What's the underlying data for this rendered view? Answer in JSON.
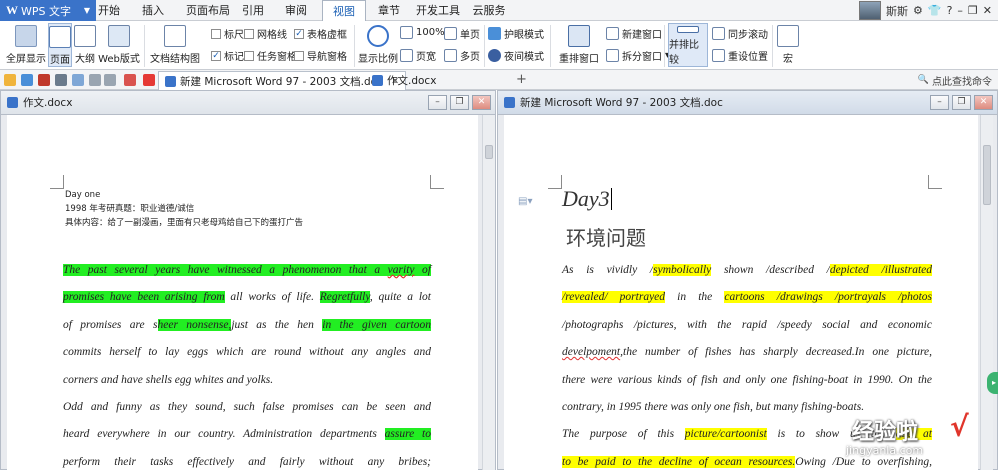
{
  "app": {
    "name": "WPS 文字",
    "logo_letter": "W"
  },
  "menu_tabs": [
    "开始",
    "插入",
    "页面布局",
    "引用",
    "审阅",
    "视图",
    "章节",
    "开发工具",
    "云服务"
  ],
  "active_menu_tab": "视图",
  "user": {
    "name": "斯斯"
  },
  "ribbon": {
    "full_display": "全屏显示",
    "page_view": "页面",
    "outline_view": "大纲",
    "web_view": "Web版式",
    "doc_structure": "文档结构图",
    "ruler": "标尺",
    "gridlines": "网格线",
    "table_frame": "表格虚框",
    "marks": "标记",
    "task_pane": "任务窗格",
    "nav_pane": "导航窗格",
    "zoom": "显示比例",
    "zoom_100": "100%",
    "page_width": "页宽",
    "single_page": "单页",
    "multi_page": "多页",
    "eye_mode": "护眼模式",
    "night_mode": "夜间模式",
    "rearrange": "重排窗口",
    "new_window": "新建窗口",
    "split_window": "拆分窗口",
    "side_by_side": "并排比较",
    "sync_scroll": "同步滚动",
    "reset_position": "重设位置",
    "macro": "宏"
  },
  "doc_tabs": [
    {
      "label": "新建 Microsoft Word 97 - 2003 文档.doc",
      "active": true
    },
    {
      "label": "作文.docx",
      "active": false
    }
  ],
  "search_label": "点此查找命令",
  "left_pane": {
    "title": "作文.docx",
    "header_lines": [
      "Day one",
      "1998 年考研真题：职业道德/诚信",
      "具体内容：给了一副漫画，里面有只老母鸡给自己下的蛋打广告"
    ],
    "paragraph_lines": [
      [
        {
          "t": "The past several years have witnessed a phenomenon that a ",
          "h": true
        },
        {
          "t": "varity",
          "h": true,
          "u": true
        },
        {
          "t": " of",
          "h": true
        }
      ],
      [
        {
          "t": "promises have been arising from",
          "h": true
        },
        {
          "t": " all works of life. ",
          "h": false
        },
        {
          "t": "Regretfully",
          "h": true
        },
        {
          "t": ", quite a lot",
          "h": false
        }
      ],
      [
        {
          "t": "of promises are s",
          "h": false
        },
        {
          "t": "heer nonsense,",
          "h": true
        },
        {
          "t": "just as the hen ",
          "h": false
        },
        {
          "t": "in the given cartoon",
          "h": true
        }
      ],
      [
        {
          "t": "commits herself to lay eggs which are round without any angles and",
          "h": false
        }
      ],
      [
        {
          "t": "corners and have shells egg whites and yolks.",
          "h": false
        }
      ],
      [
        {
          "t": "Odd and funny as they sound, such false promises can be seen and",
          "h": false
        }
      ],
      [
        {
          "t": "heard everywhere in our country. Administration departments ",
          "h": false
        },
        {
          "t": "assure to",
          "h": true
        }
      ],
      [
        {
          "t": "perform their tasks effectively and fairly without any bribes;",
          "h": false
        }
      ]
    ]
  },
  "right_pane": {
    "title": "新建 Microsoft Word 97 - 2003 文档.doc",
    "heading": "Day3",
    "subheading": "环境问题",
    "paragraph_lines": [
      [
        {
          "t": "As is vividly /",
          "h": false
        },
        {
          "t": "symbolically",
          "h": true
        },
        {
          "t": " shown /described /",
          "h": false
        },
        {
          "t": "depicted /illustrated",
          "h": true
        }
      ],
      [
        {
          "t": "/revealed/ portrayed",
          "h": true
        },
        {
          "t": " in the ",
          "h": false
        },
        {
          "t": "cartoons /drawings /portrayals /photos",
          "h": true
        }
      ],
      [
        {
          "t": "/photographs /pictures, with the rapid /speedy social and economic",
          "h": false
        }
      ],
      [
        {
          "t": "develpoment",
          "h": false,
          "sq": true
        },
        {
          "t": ",the number of fishes has sharply decreased.In one picture,",
          "h": false
        }
      ],
      [
        {
          "t": "there were various kinds of fish and only one fishing-boat in 1990. On the",
          "h": false
        }
      ],
      [
        {
          "t": "contrary, in 1995 there was only one fish, but many fishing-boats.",
          "h": false
        }
      ],
      [
        {
          "t": "The purpose of this ",
          "h": false
        },
        {
          "t": "picture/cartoonist",
          "h": true
        },
        {
          "t": " is to show us the ",
          "h": false
        },
        {
          "t": "due at",
          "h": true
        }
      ],
      [
        {
          "t": "to be paid to the decline of ocean resources.",
          "h": true
        },
        {
          "t": "Owing /Due t",
          "h": false
        },
        {
          "t": "o",
          "h": false
        },
        {
          "t": " overfishing,",
          "h": false
        }
      ]
    ]
  },
  "watermark": {
    "text": "经验啦",
    "url": "jingyanla.com",
    "check": "√"
  },
  "colors": {
    "accent": "#3a73c9",
    "green_highlight": "#22ee22",
    "yellow_highlight": "#ffff00"
  }
}
